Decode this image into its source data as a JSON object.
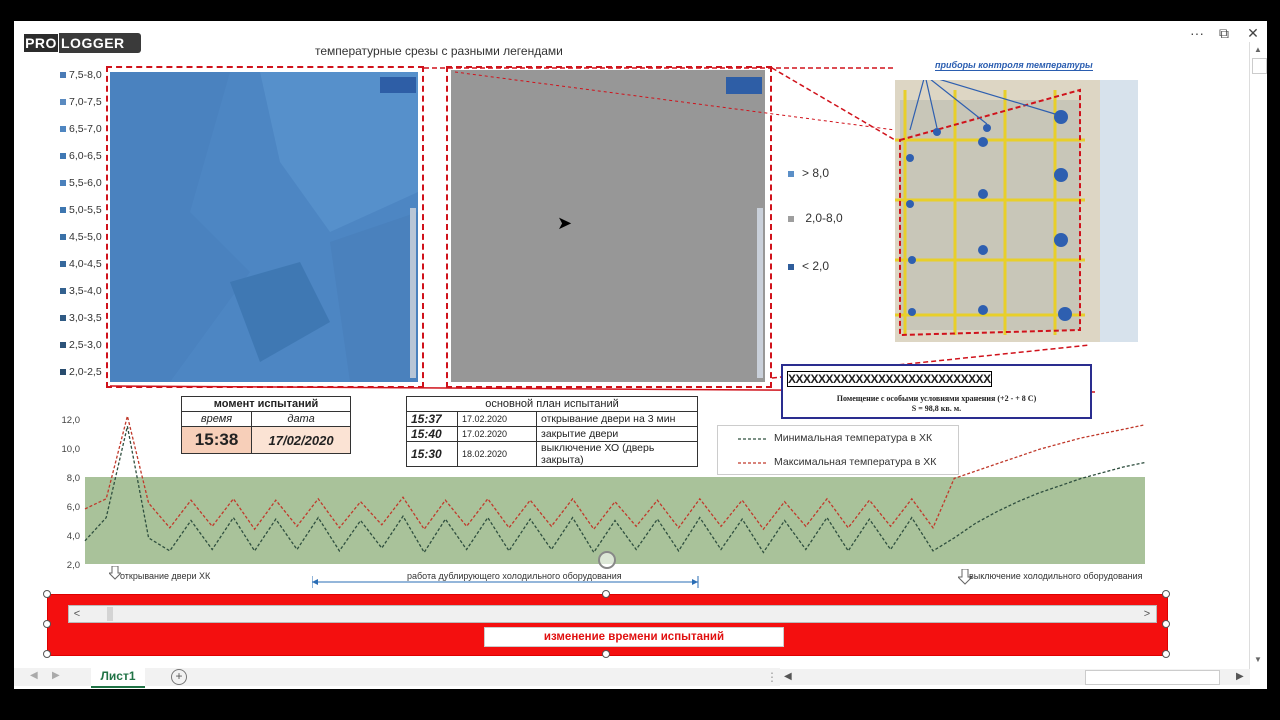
{
  "brand": {
    "pro": "PRO",
    "logger": "LOGGER"
  },
  "title": "температурные срезы с разными легендами",
  "legend_left": [
    {
      "label": "7,5-8,0",
      "color": "#4a7bb6"
    },
    {
      "label": "7,0-7,5",
      "color": "#5a8ac0"
    },
    {
      "label": "6,5-7,0",
      "color": "#4f86c1"
    },
    {
      "label": "6,0-6,5",
      "color": "#3f78b4"
    },
    {
      "label": "5,5-6,0",
      "color": "#4a80bb"
    },
    {
      "label": "5,0-5,5",
      "color": "#3d76b0"
    },
    {
      "label": "4,5-5,0",
      "color": "#3a71a8"
    },
    {
      "label": "4,0-4,5",
      "color": "#36689c"
    },
    {
      "label": "3,5-4,0",
      "color": "#33618f"
    },
    {
      "label": "3,0-3,5",
      "color": "#2f5a84"
    },
    {
      "label": "2,5-3,0",
      "color": "#2c5379"
    },
    {
      "label": "2,0-2,5",
      "color": "#284c6e"
    }
  ],
  "legend_right": [
    {
      "symbol": ">",
      "label": "8,0",
      "color": "#5b8fc7"
    },
    {
      "symbol": "",
      "label": "2,0-8,0",
      "color": "#9e9e9e"
    },
    {
      "symbol": "<",
      "label": "2,0",
      "color": "#2f5d9b"
    }
  ],
  "photo": {
    "caption": "приборы контроля температуры",
    "panel_strip": "XXXXXXXXXXXXXXXXXXXXXXXXXXX",
    "room_line1": "Помещение с особыми условиями хранения (+2 - + 8 С)",
    "room_line2": "S = 98,8 кв. м."
  },
  "moment": {
    "header": "момент испытаний",
    "time_label": "время",
    "date_label": "дата",
    "time": "15:38",
    "date": "17/02/2020"
  },
  "plan": {
    "header": "основной план испытаний",
    "rows": [
      {
        "time": "15:37",
        "date": "17.02.2020",
        "event": "открывание двери на 3 мин"
      },
      {
        "time": "15:40",
        "date": "17.02.2020",
        "event": "закрытие двери"
      },
      {
        "time": "15:30",
        "date": "18.02.2020",
        "event": "выключение ХО (дверь закрыта)"
      }
    ]
  },
  "chart_legend": {
    "min": "Минимальная температура в ХК",
    "max": "Максимальная температура в ХК",
    "min_color": "#2f4f3f",
    "max_color": "#c0392b"
  },
  "annotations": {
    "door_open": "открывание двери ХК",
    "backup": "работа дублирующего холодильного оборудования",
    "shutdown": "выключение холодильного оборудования"
  },
  "control": {
    "label": "изменение времени испытаний",
    "left_arrow": "<",
    "right_arrow": ">"
  },
  "sheet": {
    "tab": "Лист1",
    "add": "+"
  },
  "window_buttons": {
    "more": "···",
    "restore": "⧉",
    "close": "✕"
  },
  "chart_data": {
    "type": "line",
    "x": [
      0,
      1,
      2,
      3,
      4,
      5,
      6,
      7,
      8,
      9,
      10,
      11,
      12,
      13,
      14,
      15,
      16,
      17,
      18,
      19,
      20,
      21,
      22,
      23,
      24,
      25,
      26,
      27,
      28,
      29,
      30,
      31,
      32,
      33,
      34,
      35,
      36,
      37,
      38,
      39,
      40,
      41,
      42,
      43,
      44,
      45,
      46,
      47,
      48,
      49,
      50
    ],
    "ylim": [
      2.0,
      12.0
    ],
    "yticks": [
      "12,0",
      "10,0",
      "8,0",
      "6,0",
      "4,0",
      "2,0"
    ],
    "band": [
      2.0,
      8.0
    ],
    "band_color": "#a9c29a",
    "series": [
      {
        "name": "Минимальная температура в ХК",
        "color": "#2f4f3f",
        "values": [
          3.6,
          5.2,
          11.5,
          3.8,
          2.9,
          5.0,
          3.0,
          5.2,
          2.9,
          5.1,
          3.0,
          5.2,
          2.9,
          5.0,
          3.1,
          5.3,
          2.8,
          5.1,
          3.0,
          5.2,
          2.9,
          5.1,
          3.0,
          5.2,
          2.8,
          5.0,
          3.0,
          5.1,
          2.9,
          5.2,
          3.0,
          5.1,
          2.8,
          5.0,
          3.0,
          5.2,
          2.9,
          5.1,
          3.0,
          5.2,
          2.9,
          3.8,
          4.8,
          5.6,
          6.3,
          6.9,
          7.4,
          7.9,
          8.3,
          8.7,
          9.0
        ]
      },
      {
        "name": "Максимальная температура в ХК",
        "color": "#c0392b",
        "values": [
          5.8,
          6.5,
          12.2,
          6.2,
          4.5,
          6.4,
          4.6,
          6.5,
          4.4,
          6.4,
          4.6,
          6.5,
          4.5,
          6.3,
          4.7,
          6.6,
          4.4,
          6.4,
          4.6,
          6.5,
          4.5,
          6.4,
          4.6,
          6.5,
          4.4,
          6.3,
          4.6,
          6.4,
          4.5,
          6.5,
          4.6,
          6.4,
          4.4,
          6.3,
          4.6,
          6.5,
          4.5,
          6.4,
          4.6,
          6.5,
          4.5,
          7.9,
          8.4,
          8.9,
          9.4,
          9.9,
          10.3,
          10.7,
          11.0,
          11.3,
          11.6
        ]
      }
    ]
  }
}
